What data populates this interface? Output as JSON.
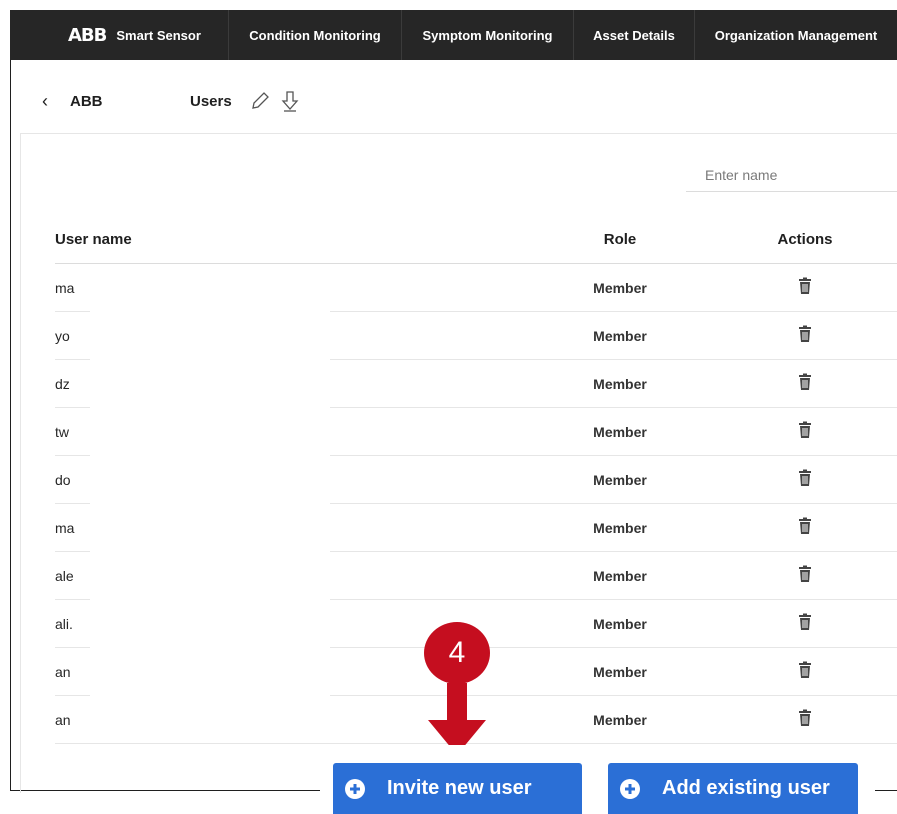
{
  "nav": {
    "brand_logo": "ABB",
    "app_name": "Smart Sensor",
    "tabs": [
      {
        "label": "Condition Monitoring"
      },
      {
        "label": "Symptom Monitoring"
      },
      {
        "label": "Asset Details"
      },
      {
        "label": "Organization Management"
      }
    ]
  },
  "breadcrumb": {
    "back_icon": "chevron-left-icon",
    "organization": "ABB",
    "section": "Users",
    "edit_icon": "pencil-icon",
    "download_icon": "download-arrow-icon"
  },
  "search": {
    "placeholder": "Enter name",
    "value": ""
  },
  "table": {
    "headers": {
      "name": "User name",
      "role": "Role",
      "actions": "Actions"
    },
    "rows": [
      {
        "name": "ma",
        "role": "Member"
      },
      {
        "name": "yo",
        "role": "Member"
      },
      {
        "name": "dz",
        "role": "Member"
      },
      {
        "name": "tw",
        "role": "Member"
      },
      {
        "name": "do",
        "role": "Member"
      },
      {
        "name": "ma",
        "role": "Member"
      },
      {
        "name": "ale",
        "role": "Member"
      },
      {
        "name": "ali.",
        "role": "Member"
      },
      {
        "name": "an",
        "role": "Member"
      },
      {
        "name": "an",
        "role": "Member"
      }
    ],
    "action_icon": "trash-icon"
  },
  "annotation": {
    "step": "4",
    "color": "#c50e1f"
  },
  "buttons": {
    "invite": "Invite new user",
    "add_existing": "Add existing user",
    "color": "#2b6fd6"
  }
}
